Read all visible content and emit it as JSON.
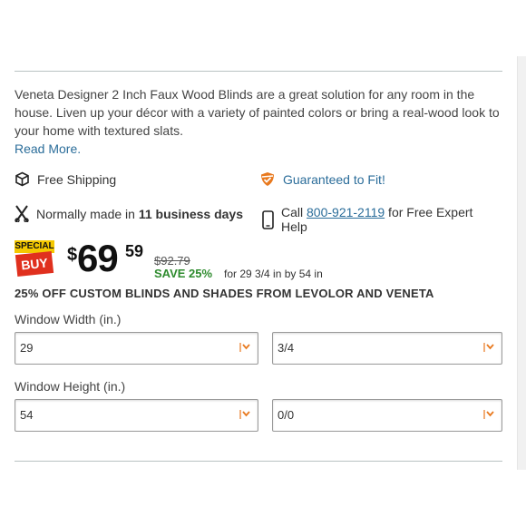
{
  "description": {
    "text": "Veneta Designer 2 Inch Faux Wood Blinds are a great solution for any room in the house. Liven up your décor with a variety of painted colors or bring a real-wood look to your home with textured slats.",
    "read_more": "Read More."
  },
  "features": {
    "shipping": "Free Shipping",
    "guarantee": "Guaranteed to Fit!",
    "made_prefix": "Normally made in ",
    "made_days": "11 business days",
    "call_prefix": "Call ",
    "phone": "800-921-2119",
    "call_suffix": " for Free Expert Help"
  },
  "badge": {
    "special": "SPECIAL",
    "buy": "BUY"
  },
  "price": {
    "currency": "$",
    "dollars": "69",
    "cents": "59",
    "was": "$92.79",
    "save": "SAVE 25%",
    "size_for": "for 29 3/4 in by 54 in"
  },
  "promo": "25% OFF CUSTOM BLINDS AND SHADES FROM LEVOLOR AND VENETA",
  "width": {
    "label": "Window Width (in.)",
    "whole": "29",
    "fraction": "3/4"
  },
  "height": {
    "label": "Window Height (in.)",
    "whole": "54",
    "fraction": "0/0"
  },
  "colors": {
    "link": "#2b6d9a",
    "save": "#2e8b2e",
    "accent_orange": "#e8791e",
    "badge_red": "#e0301e",
    "badge_yellow": "#f4c800"
  }
}
